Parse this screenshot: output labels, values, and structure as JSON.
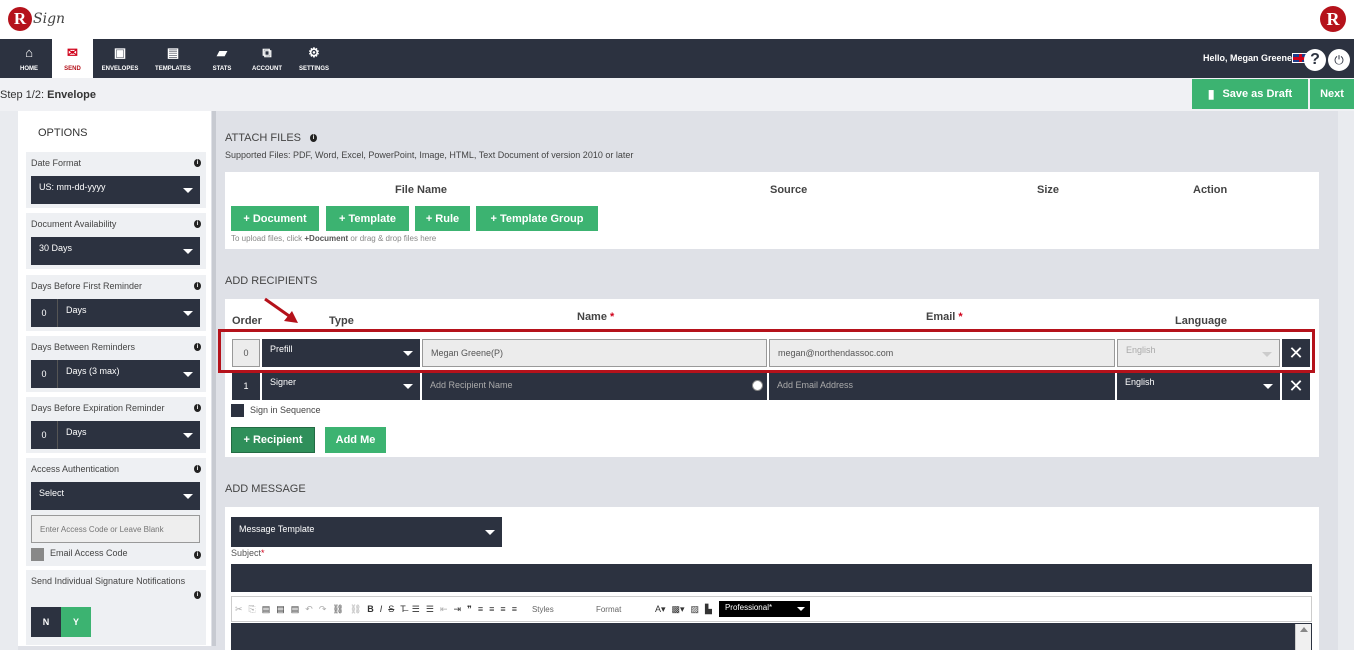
{
  "header": {
    "logo_text": "Sign",
    "greeting": "Hello, Megan Greene"
  },
  "nav": {
    "items": [
      {
        "label": "HOME",
        "icon": "home-icon"
      },
      {
        "label": "SEND",
        "icon": "envelope-icon"
      },
      {
        "label": "ENVELOPES",
        "icon": "envelopes-icon"
      },
      {
        "label": "TEMPLATES",
        "icon": "templates-icon"
      },
      {
        "label": "STATS",
        "icon": "briefcase-icon"
      },
      {
        "label": "ACCOUNT",
        "icon": "account-icon"
      },
      {
        "label": "SETTINGS",
        "icon": "gear-icon"
      }
    ],
    "active": "SEND"
  },
  "step": {
    "prefix": "Step 1/2:",
    "name": "Envelope"
  },
  "actions": {
    "save_draft": "Save as Draft",
    "next": "Next"
  },
  "options": {
    "title": "OPTIONS",
    "date_format": {
      "label": "Date Format",
      "value": "US: mm-dd-yyyy"
    },
    "doc_availability": {
      "label": "Document Availability",
      "value": "30 Days"
    },
    "first_reminder": {
      "label": "Days Before First Reminder",
      "number": "0",
      "unit": "Days"
    },
    "between_reminders": {
      "label": "Days Between Reminders",
      "number": "0",
      "unit": "Days (3 max)"
    },
    "expiration_reminder": {
      "label": "Days Before Expiration Reminder",
      "number": "0",
      "unit": "Days"
    },
    "access_auth": {
      "label": "Access Authentication",
      "value": "Select",
      "placeholder": "Enter Access Code or Leave Blank",
      "email_code_label": "Email Access Code"
    },
    "individual_notifications": {
      "label": "Send Individual Signature Notifications",
      "no": "N",
      "yes": "Y"
    }
  },
  "attach": {
    "title": "ATTACH FILES",
    "supported": "Supported Files: PDF, Word, Excel, PowerPoint, Image, HTML, Text Document of version 2010 or later",
    "columns": [
      "File Name",
      "Source",
      "Size",
      "Action"
    ],
    "buttons": [
      "+ Document",
      "+ Template",
      "+ Rule",
      "+ Template Group"
    ],
    "hint_pre": "To upload files, click ",
    "hint_bold": "+Document",
    "hint_post": " or drag & drop files here"
  },
  "recipients": {
    "title": "ADD RECIPIENTS",
    "columns": {
      "order": "Order",
      "type": "Type",
      "name": "Name",
      "email": "Email",
      "language": "Language"
    },
    "rows": [
      {
        "order": "0",
        "type": "Prefill",
        "name": "Megan Greene(P)",
        "email": "megan@northendassoc.com",
        "language": "English"
      },
      {
        "order": "1",
        "type": "Signer",
        "name_placeholder": "Add Recipient Name",
        "email_placeholder": "Add Email Address",
        "language": "English"
      }
    ],
    "sign_in_sequence": "Sign in Sequence",
    "add_recipient": "+ Recipient",
    "add_me": "Add Me"
  },
  "message": {
    "title": "ADD MESSAGE",
    "template": "Message Template",
    "subject_label": "Subject",
    "styles": "Styles",
    "format": "Format",
    "theme": "Professional*"
  },
  "colors": {
    "nav_bg": "#2c3240",
    "accent_green": "#3cb371",
    "brand_red": "#b5121b"
  }
}
